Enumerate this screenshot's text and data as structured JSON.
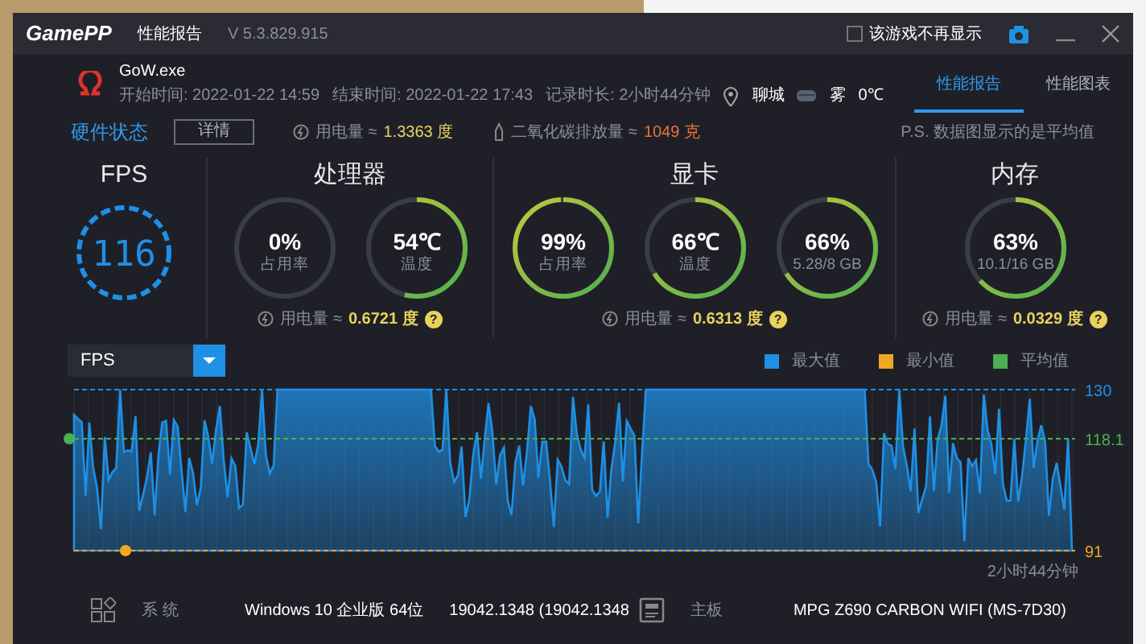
{
  "app": {
    "logo": "GamePP",
    "title": "性能报告",
    "version": "V 5.3.829.915",
    "hide_option": {
      "label": "该游戏不再显示",
      "checked": false
    }
  },
  "session": {
    "game": "GoW.exe",
    "start": "开始时间: 2022-01-22 14:59",
    "end": "结束时间: 2022-01-22 17:43",
    "duration": "记录时长: 2小时44分钟",
    "city": "聊城",
    "weather": "雾",
    "temperature": "0℃"
  },
  "tabs": [
    {
      "label": "性能报告",
      "selected": true
    },
    {
      "label": "性能图表",
      "selected": false
    }
  ],
  "hardware": {
    "title": "硬件状态",
    "details_button": "详情",
    "power_label": "用电量 ≈",
    "power_value": "1.3363 度",
    "co2_label": "二氧化碳排放量 ≈",
    "co2_value": "1049 克",
    "note": "P.S. 数据图显示的是平均值"
  },
  "fps": {
    "title": "FPS",
    "value": "116"
  },
  "groups": [
    {
      "title": "处理器",
      "gauges": [
        {
          "value": "0%",
          "label": "占用率",
          "level": 0
        },
        {
          "value": "54℃",
          "label": "温度",
          "level": 0.54
        }
      ],
      "power_label": "用电量 ≈",
      "power_value": "0.6721 度",
      "help": "?"
    },
    {
      "title": "显卡",
      "gauges": [
        {
          "value": "99%",
          "label": "占用率",
          "level": 0.99
        },
        {
          "value": "66℃",
          "label": "温度",
          "level": 0.66
        },
        {
          "value": "66%",
          "label": "5.28/8 GB",
          "level": 0.66
        }
      ],
      "power_label": "用电量 ≈",
      "power_value": "0.6313 度",
      "help": "?"
    },
    {
      "title": "内存",
      "gauges": [
        {
          "value": "63%",
          "label": "10.1/16 GB",
          "level": 0.63
        }
      ],
      "power_label": "用电量 ≈",
      "power_value": "0.0329 度",
      "help": "?"
    }
  ],
  "chart": {
    "metric": "FPS",
    "legend": [
      {
        "label": "最大值",
        "color": "#1e90e6"
      },
      {
        "label": "最小值",
        "color": "#f0a823"
      },
      {
        "label": "平均值",
        "color": "#4caf50"
      }
    ],
    "max_label": "130",
    "avg_label": "118.1",
    "min_label": "91",
    "duration": "2小时44分钟"
  },
  "info": [
    {
      "kind": "system",
      "label": "系 统",
      "value": "Windows 10 企业版 64位",
      "extra": "19042.1348 (19042.1348"
    },
    {
      "kind": "board",
      "label": "主板",
      "value": "MPG Z690 CARBON WIFI (MS-7D30)"
    }
  ]
}
